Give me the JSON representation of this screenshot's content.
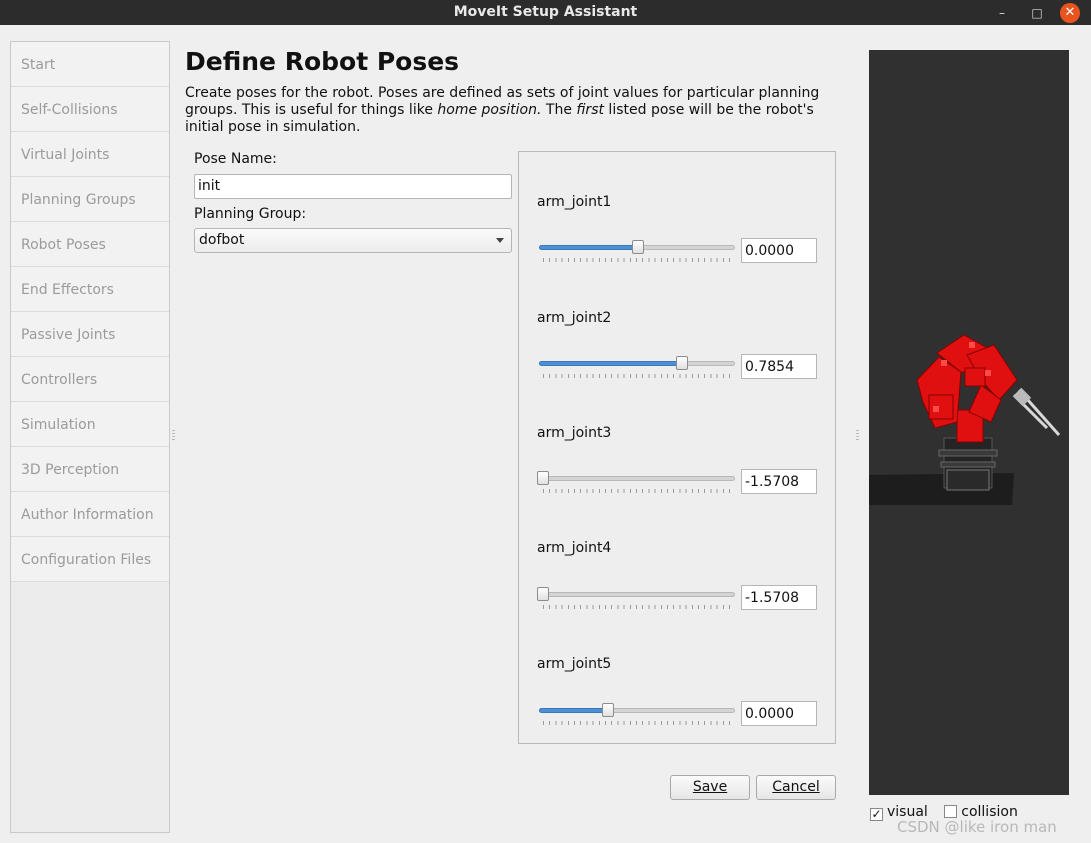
{
  "window": {
    "title": "MoveIt Setup Assistant",
    "buttons": {
      "minimize": "–",
      "maximize": "□",
      "close": "✕"
    }
  },
  "sidebar": {
    "items": [
      {
        "label": "Start"
      },
      {
        "label": "Self-Collisions"
      },
      {
        "label": "Virtual Joints"
      },
      {
        "label": "Planning Groups"
      },
      {
        "label": "Robot Poses"
      },
      {
        "label": "End Effectors"
      },
      {
        "label": "Passive Joints"
      },
      {
        "label": "Controllers"
      },
      {
        "label": "Simulation"
      },
      {
        "label": "3D Perception"
      },
      {
        "label": "Author Information"
      },
      {
        "label": "Configuration Files"
      }
    ]
  },
  "main": {
    "title": "Define Robot Poses",
    "description": {
      "part1": "Create poses for the robot. Poses are defined as sets of joint values for particular planning groups. This is useful for things like ",
      "em1": "home position.",
      "part2": " The ",
      "em2": "first",
      "part3": " listed pose will be the robot's initial pose in simulation."
    },
    "pose_name_label": "Pose Name:",
    "pose_name_value": "init",
    "planning_group_label": "Planning Group:",
    "planning_group_value": "dofbot",
    "joints": [
      {
        "label": "arm_joint1",
        "value": "0.0000",
        "slider_fraction": 0.5
      },
      {
        "label": "arm_joint2",
        "value": "0.7854",
        "slider_fraction": 0.73
      },
      {
        "label": "arm_joint3",
        "value": "-1.5708",
        "slider_fraction": 0.0
      },
      {
        "label": "arm_joint4",
        "value": "-1.5708",
        "slider_fraction": 0.0
      },
      {
        "label": "arm_joint5",
        "value": "0.0000",
        "slider_fraction": 0.34
      }
    ],
    "save_label": "Save",
    "cancel_label": "Cancel"
  },
  "viewer": {
    "visual_label": "visual",
    "visual_checked": true,
    "collision_label": "collision",
    "collision_checked": false,
    "robot_color": "#e01010"
  },
  "watermark": "CSDN @like iron man"
}
